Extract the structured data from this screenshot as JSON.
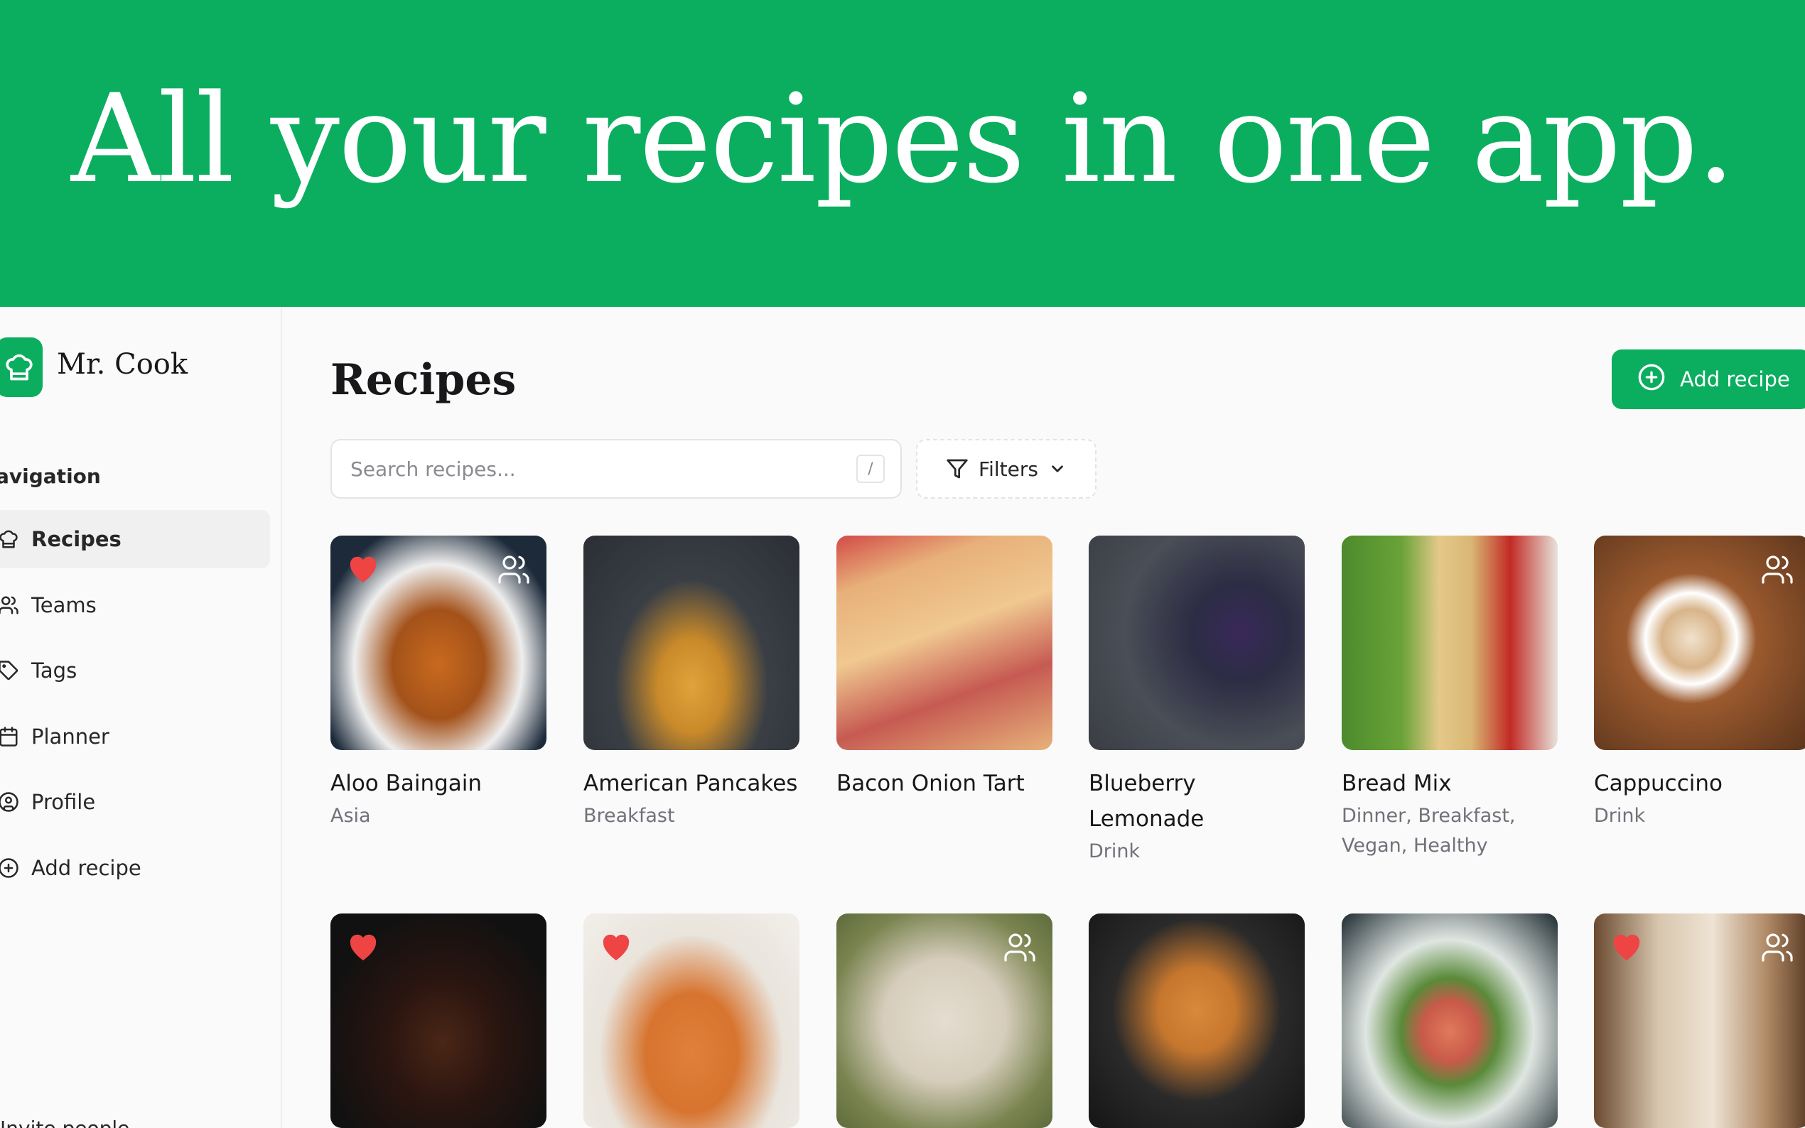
{
  "hero": {
    "title": "All your recipes in one app."
  },
  "sidebar": {
    "app_name": "Mr. Cook",
    "nav_heading": "avigation",
    "items": [
      {
        "label": "Recipes",
        "icon": "chef-hat-icon",
        "active": true
      },
      {
        "label": "Teams",
        "icon": "users-icon",
        "active": false
      },
      {
        "label": "Tags",
        "icon": "tag-icon",
        "active": false
      },
      {
        "label": "Planner",
        "icon": "calendar-icon",
        "active": false
      },
      {
        "label": "Profile",
        "icon": "user-circle-icon",
        "active": false
      },
      {
        "label": "Add recipe",
        "icon": "plus-circle-icon",
        "active": false
      }
    ],
    "invite_label": "Invite people"
  },
  "main": {
    "title": "Recipes",
    "add_button": "Add recipe",
    "search": {
      "placeholder": "Search recipes...",
      "shortcut": "/"
    },
    "filters_label": "Filters"
  },
  "recipes": [
    {
      "title": "Aloo Baingain",
      "subtitle": "Asia",
      "favorite": true,
      "shared": true
    },
    {
      "title": "American Pancakes",
      "subtitle": "Breakfast",
      "favorite": false,
      "shared": false
    },
    {
      "title": "Bacon Onion Tart",
      "subtitle": "",
      "favorite": false,
      "shared": false
    },
    {
      "title": "Blueberry Lemonade",
      "subtitle": "Drink",
      "favorite": false,
      "shared": false
    },
    {
      "title": "Bread Mix",
      "subtitle": "Dinner, Breakfast, Vegan, Healthy",
      "favorite": false,
      "shared": false
    },
    {
      "title": "Cappuccino",
      "subtitle": "Drink",
      "favorite": false,
      "shared": true
    },
    {
      "title": "",
      "subtitle": "",
      "favorite": true,
      "shared": false
    },
    {
      "title": "",
      "subtitle": "",
      "favorite": true,
      "shared": false
    },
    {
      "title": "",
      "subtitle": "",
      "favorite": false,
      "shared": true
    },
    {
      "title": "",
      "subtitle": "",
      "favorite": false,
      "shared": false
    },
    {
      "title": "",
      "subtitle": "",
      "favorite": false,
      "shared": false
    },
    {
      "title": "",
      "subtitle": "",
      "favorite": true,
      "shared": true
    }
  ],
  "colors": {
    "brand": "#0bae5f",
    "heart": "#ef4444"
  }
}
